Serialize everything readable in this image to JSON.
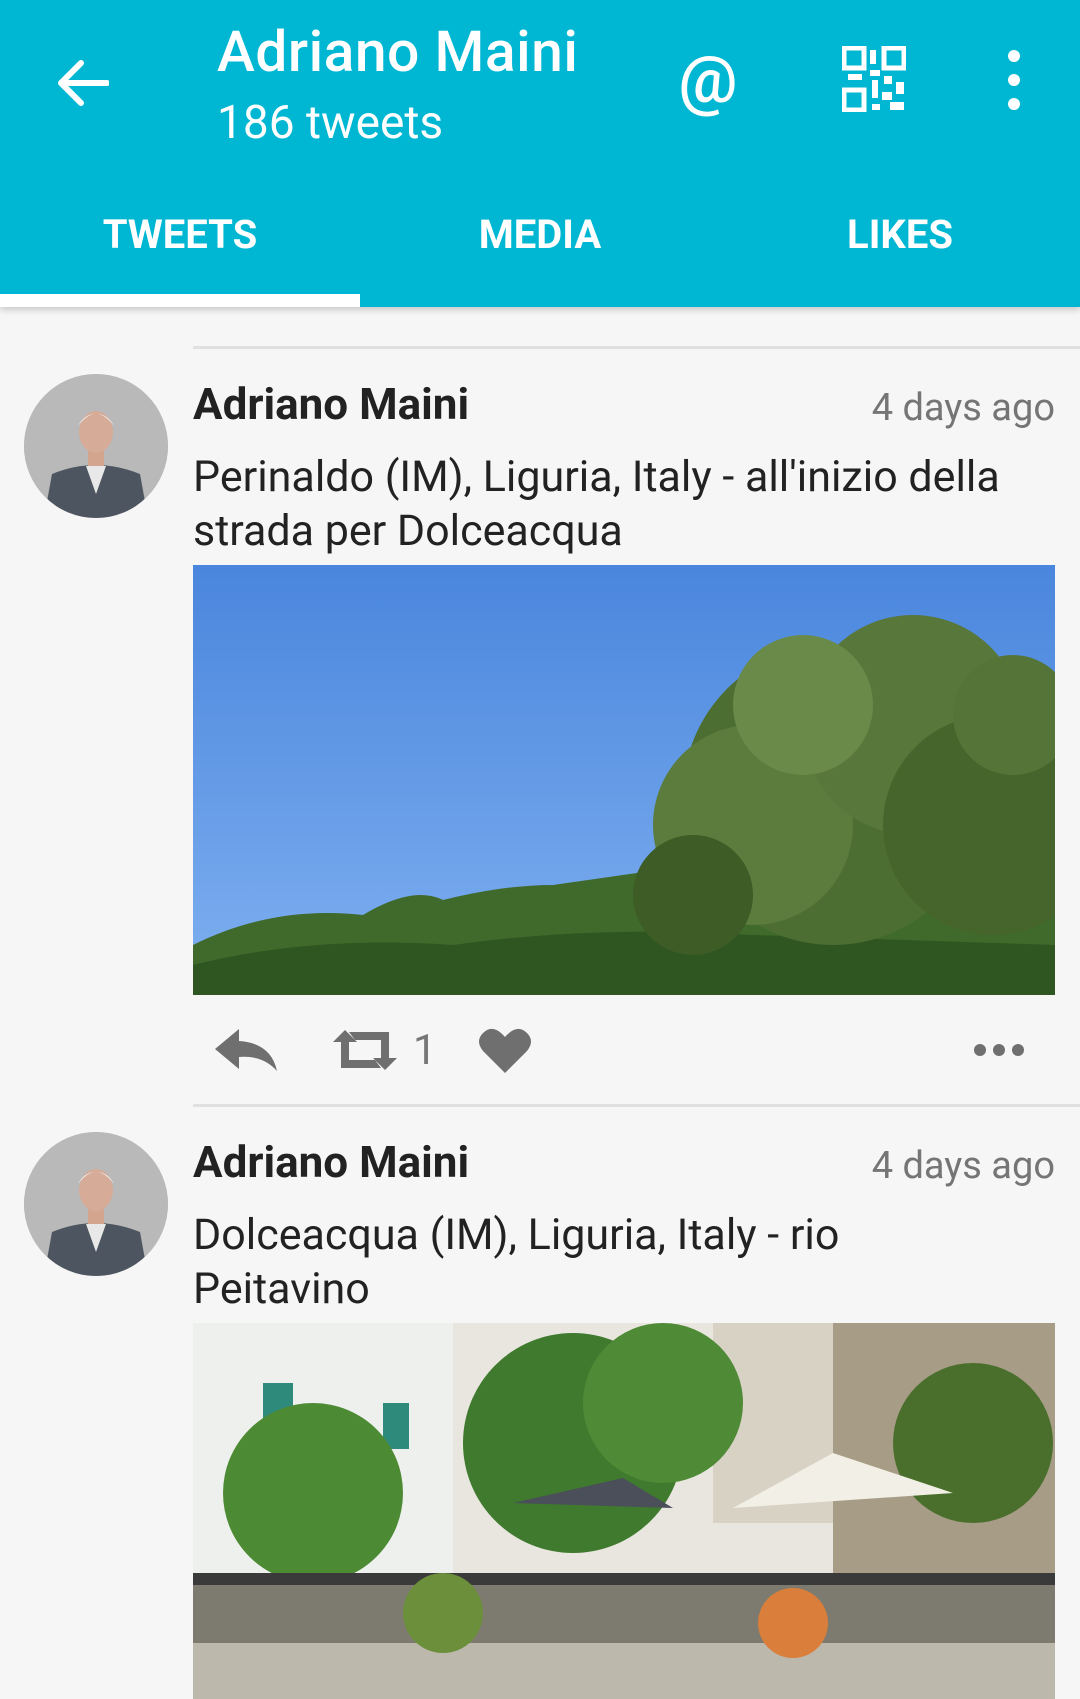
{
  "header": {
    "title": "Adriano Maini",
    "subtitle": "186 tweets",
    "at_symbol": "@",
    "back_icon": "arrow-left-icon",
    "qr_icon": "qr-code-icon",
    "more_icon": "more-vert-icon"
  },
  "tabs": [
    {
      "label": "TWEETS",
      "active": true
    },
    {
      "label": "MEDIA",
      "active": false
    },
    {
      "label": "LIKES",
      "active": false
    }
  ],
  "colors": {
    "accent": "#00b7d3",
    "like": "#e91e63",
    "icon_gray": "#6f6f6f"
  },
  "tweets": [
    {
      "author": "Adriano Maini",
      "time": "4 days ago",
      "text": "Perinaldo (IM), Liguria, Italy - all'inizio della strada per Dolceacqua",
      "media": "photo-hills-olive-tree",
      "retweet_count": "1",
      "icons": [
        "reply-icon",
        "retweet-icon",
        "heart-icon",
        "more-horiz-icon"
      ]
    },
    {
      "author": "Adriano Maini",
      "time": "4 days ago",
      "text": "Dolceacqua (IM), Liguria, Italy - rio Peitavino",
      "media": "photo-village-terrace-umbrellas"
    }
  ]
}
